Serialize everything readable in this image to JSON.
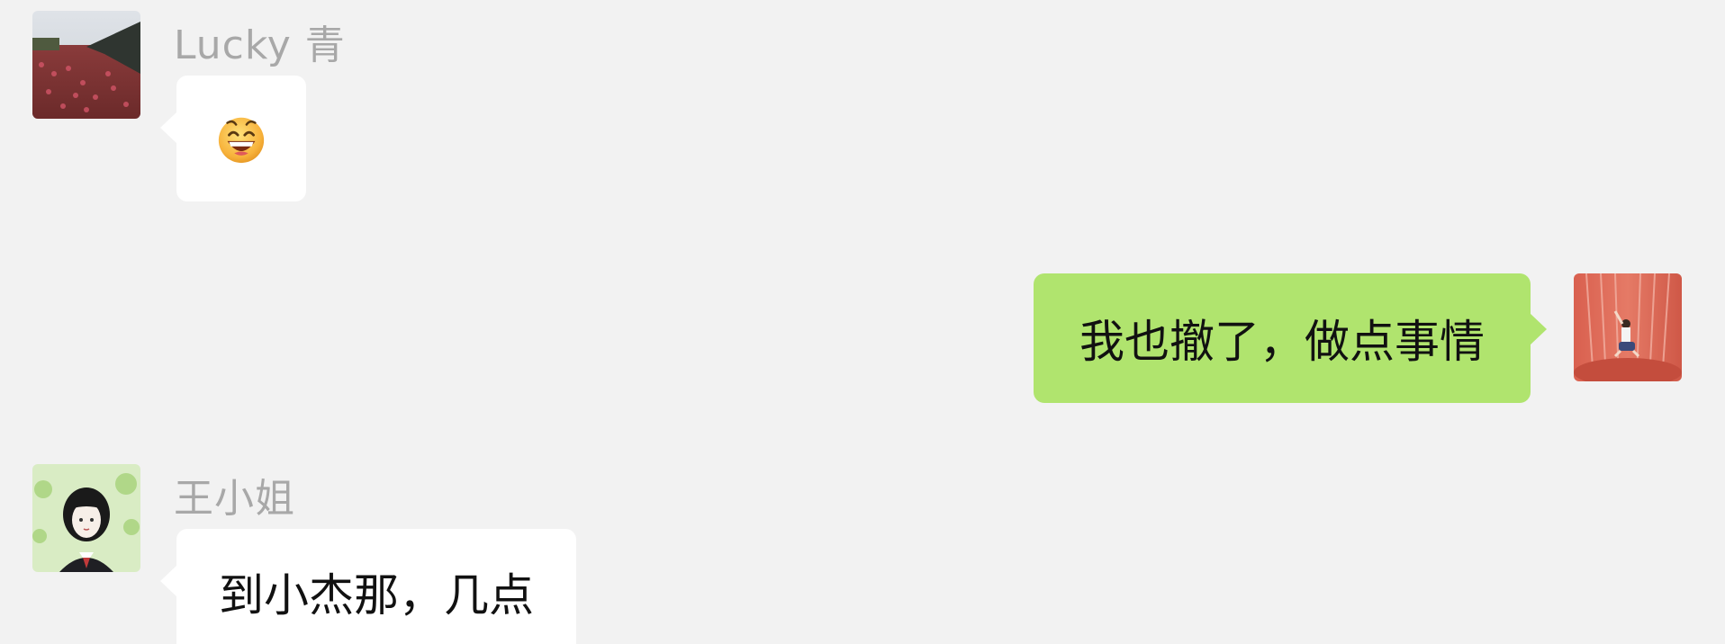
{
  "messages": [
    {
      "direction": "incoming",
      "sender": "Lucky 青",
      "type": "emoji",
      "icon": "grinning-face-icon",
      "text": ""
    },
    {
      "direction": "outgoing",
      "sender": "",
      "type": "text",
      "text": "我也撤了，做点事情"
    },
    {
      "direction": "incoming",
      "sender": "王小姐",
      "type": "text",
      "text": "到小杰那，几点"
    }
  ],
  "colors": {
    "background": "#f2f2f2",
    "incoming_bubble": "#ffffff",
    "outgoing_bubble": "#b0e46e",
    "sender_name": "#a8a8a8",
    "message_text": "#111111"
  }
}
